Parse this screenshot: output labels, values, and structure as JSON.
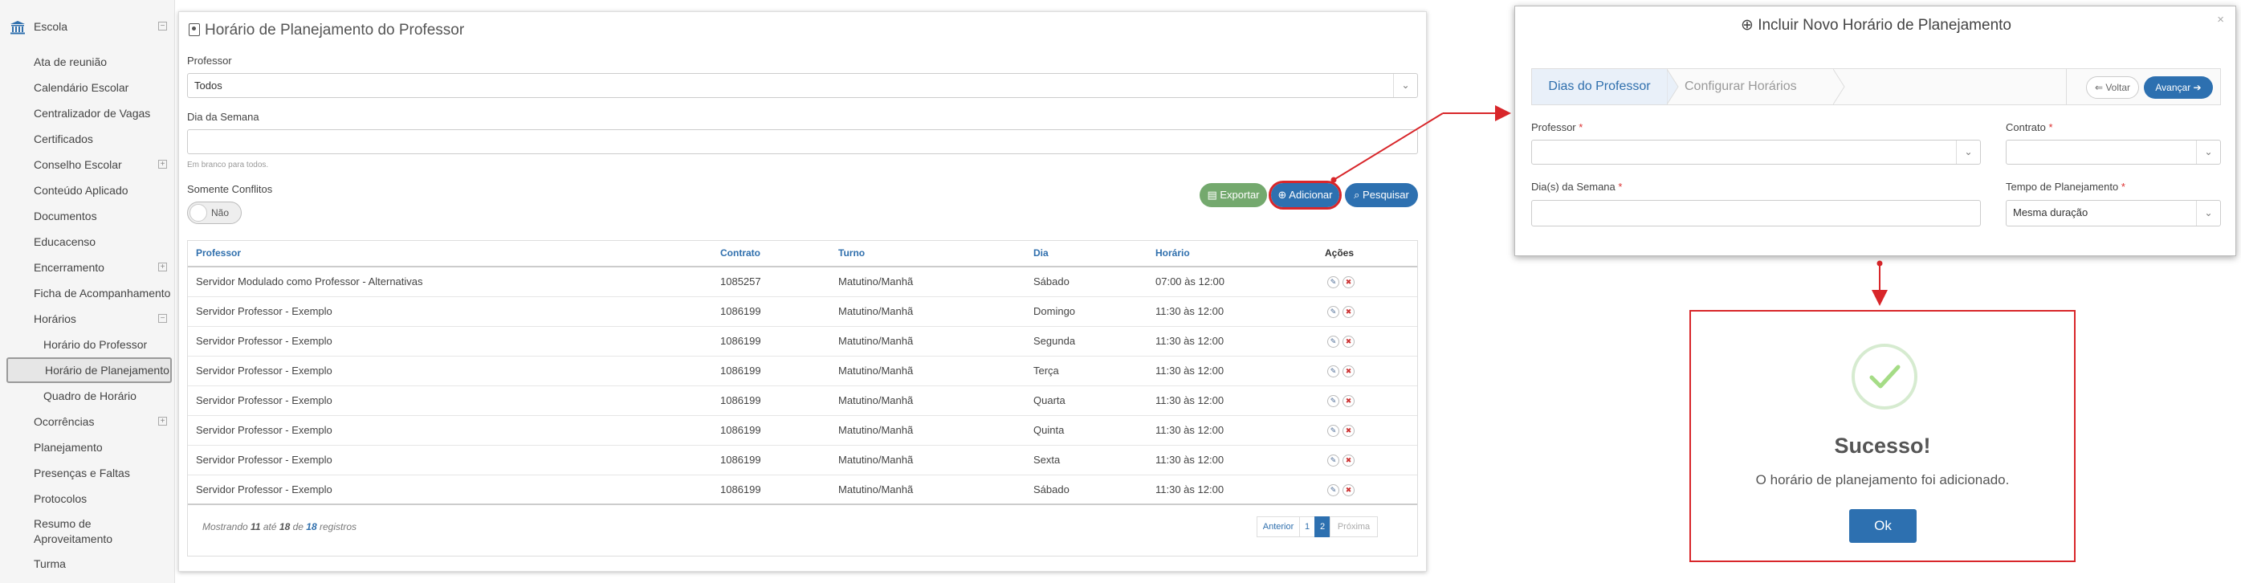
{
  "sidebar": {
    "school": "Escola",
    "items": [
      {
        "label": "Ata de reunião"
      },
      {
        "label": "Calendário Escolar"
      },
      {
        "label": "Centralizador de Vagas"
      },
      {
        "label": "Certificados"
      },
      {
        "label": "Conselho Escolar"
      },
      {
        "label": "Conteúdo Aplicado"
      },
      {
        "label": "Documentos"
      },
      {
        "label": "Educacenso"
      },
      {
        "label": "Encerramento"
      },
      {
        "label": "Ficha de Acompanhamento"
      },
      {
        "label": "Horários"
      },
      {
        "label": "Horário do Professor"
      },
      {
        "label": "Horário de Planejamento"
      },
      {
        "label": "Quadro de Horário"
      },
      {
        "label": "Ocorrências"
      },
      {
        "label": "Planejamento"
      },
      {
        "label": "Presenças e Faltas"
      },
      {
        "label": "Protocolos"
      },
      {
        "label": "Resumo de",
        "label2": "Aproveitamento"
      },
      {
        "label": "Turma"
      }
    ]
  },
  "main": {
    "title": "Horário de Planejamento do Professor",
    "professor_label": "Professor",
    "professor_value": "Todos",
    "dia_label": "Dia da Semana",
    "dia_hint": "Em branco para todos.",
    "conflitos_label": "Somente Conflitos",
    "toggle_value": "Não",
    "btn_exportar": "Exportar",
    "btn_adicionar": "Adicionar",
    "btn_pesquisar": "Pesquisar",
    "table": {
      "headers": [
        "Professor",
        "Contrato",
        "Turno",
        "Dia",
        "Horário",
        "Ações"
      ],
      "rows": [
        [
          "Servidor Modulado como Professor - Alternativas",
          "1085257",
          "Matutino/Manhã",
          "Sábado",
          "07:00 às 12:00"
        ],
        [
          "Servidor Professor - Exemplo",
          "1086199",
          "Matutino/Manhã",
          "Domingo",
          "11:30 às 12:00"
        ],
        [
          "Servidor Professor - Exemplo",
          "1086199",
          "Matutino/Manhã",
          "Segunda",
          "11:30 às 12:00"
        ],
        [
          "Servidor Professor - Exemplo",
          "1086199",
          "Matutino/Manhã",
          "Terça",
          "11:30 às 12:00"
        ],
        [
          "Servidor Professor - Exemplo",
          "1086199",
          "Matutino/Manhã",
          "Quarta",
          "11:30 às 12:00"
        ],
        [
          "Servidor Professor - Exemplo",
          "1086199",
          "Matutino/Manhã",
          "Quinta",
          "11:30 às 12:00"
        ],
        [
          "Servidor Professor - Exemplo",
          "1086199",
          "Matutino/Manhã",
          "Sexta",
          "11:30 às 12:00"
        ],
        [
          "Servidor Professor - Exemplo",
          "1086199",
          "Matutino/Manhã",
          "Sábado",
          "11:30 às 12:00"
        ]
      ]
    },
    "footer": {
      "mostrando": "Mostrando",
      "from": "11",
      "ate": "até",
      "to": "18",
      "de": "de",
      "total": "18",
      "registros": "registros"
    },
    "pager": {
      "prev": "Anterior",
      "p1": "1",
      "p2": "2",
      "next": "Próxima"
    }
  },
  "modal": {
    "title": "Incluir Novo Horário de Planejamento",
    "close": "×",
    "step1": "Dias do Professor",
    "step2": "Configurar Horários",
    "voltar": "Voltar",
    "avancar": "Avançar",
    "professor_label": "Professor",
    "contrato_label": "Contrato",
    "dias_label": "Dia(s) da Semana",
    "tempo_label": "Tempo de Planejamento",
    "tempo_value": "Mesma duração",
    "required_mark": "*"
  },
  "success": {
    "title": "Sucesso!",
    "message": "O horário de planejamento foi adicionado.",
    "ok": "Ok"
  },
  "colors": {
    "primary": "#2d70b0",
    "success_green": "#74a96e",
    "highlight_red": "#d8262a",
    "check_green": "#a5dc86"
  }
}
